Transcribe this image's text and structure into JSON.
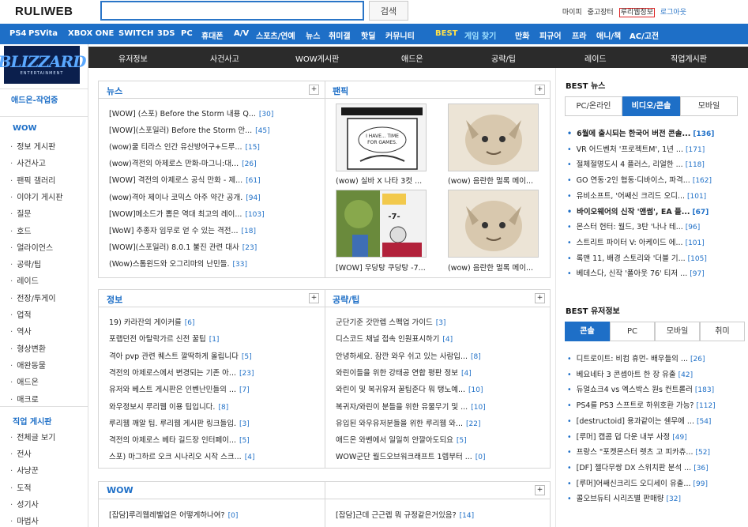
{
  "header": {
    "logo": "RULIWEB",
    "search_placeholder": "",
    "search_button": "검색",
    "links": [
      "마이피",
      "중고장터",
      "루리웹정보",
      "로그아웃"
    ]
  },
  "nav": {
    "items": [
      "PS4",
      "PSVita",
      "XBOX ONE",
      "SWITCH",
      "3DS",
      "PC",
      "휴대폰",
      "A/V",
      "스포츠/연예",
      "뉴스",
      "취미갤",
      "핫딜",
      "커뮤니티",
      "BEST",
      "게임 찾기",
      "만화",
      "피규어",
      "프라",
      "애니/책",
      "AC/고전"
    ]
  },
  "subnav": {
    "items": [
      "유저정보",
      "사건사고",
      "WOW게시판",
      "애드온",
      "공략/팁",
      "레이드",
      "직업게시판"
    ]
  },
  "sidebar": {
    "logo": "BLIZZARD",
    "logo_sub": "ENTERTAINMENT",
    "addon_title": "애드온-작업중",
    "wow_title": "WOW",
    "wow_items": [
      "정보 게시판",
      "사건사고",
      "팬픽 갤러리",
      "이야기 게시판",
      "질문",
      "호드",
      "얼라이언스",
      "공략/팁",
      "레이드",
      "전장/투게이",
      "업적",
      "역사",
      "형상변환",
      "애완동물",
      "애드온",
      "매크로"
    ],
    "job_title": "직업 게시판",
    "job_items": [
      "전체글 보기",
      "전사",
      "사냥꾼",
      "도적",
      "성기사",
      "마법사"
    ]
  },
  "news": {
    "title": "뉴스",
    "items": [
      {
        "text": "[WOW] (스포) Before the Storm 내용 Q...",
        "count": "[30]"
      },
      {
        "text": "[WOW](스포일러) Before the Storm 안...",
        "count": "[45]"
      },
      {
        "text": "(wow)쿨 티라스 인간 유산방어구+드루...",
        "count": "[15]"
      },
      {
        "text": "(wow)격전의 아제로스 만화-마그니:대...",
        "count": "[26]"
      },
      {
        "text": "[WOW] 격전의 아제로스 공식 만화 - 제...",
        "count": "[61]"
      },
      {
        "text": "(wow)격아 제이나 코믹스 아주 약간 공개.",
        "count": "[94]"
      },
      {
        "text": "[WOW]메소드가 뽑은 역대 최고의 레이...",
        "count": "[103]"
      },
      {
        "text": "[WoW] 추종자 임무로 얻 수 있는 격전...",
        "count": "[18]"
      },
      {
        "text": "[WOW](스포일러) 8.0.1 불진 관련 대사",
        "count": "[23]"
      },
      {
        "text": "(Wow)스톰윈드와 오그리마의 난민들.",
        "count": "[33]"
      }
    ]
  },
  "fanfic": {
    "title": "팬픽",
    "items": [
      {
        "caption": "(wow) 실바 X 나타 3컷 ...",
        "art": "I HAVE... TIME FOR GAMES."
      },
      {
        "caption": "(wow) 음란한 멀록 메이...",
        "art": ""
      },
      {
        "caption": "[WOW] 우당탕 쿠당탕 -7...",
        "art": "-7-"
      },
      {
        "caption": "(wow) 음란한 멀록 메이...",
        "art": ""
      }
    ]
  },
  "info": {
    "title": "정보",
    "items": [
      {
        "text": "19) 카라잔의 게이커를",
        "count": "[6]"
      },
      {
        "text": "포랩던전 아탈락가르 신전 꿀팁",
        "count": "[1]"
      },
      {
        "text": "격아 pvp 관련 퀘스트 깔딱하게 올립니다",
        "count": "[5]"
      },
      {
        "text": "격전의 아제로스에서 변경되는 기존 아...",
        "count": "[23]"
      },
      {
        "text": "유저와 베스트 게시판은 인벤난민들의 ...",
        "count": "[7]"
      },
      {
        "text": "와우정보시 루리웹 이용 팁입니다.",
        "count": "[8]"
      },
      {
        "text": "루리웹 깨알 팁. 루리웹 게시판 링크들입.",
        "count": "[3]"
      },
      {
        "text": "격전의 아제로스 베타 길드장 인터페이...",
        "count": "[5]"
      },
      {
        "text": "스포) 마그하르 오크 시나리오 시작 스크...",
        "count": "[4]"
      }
    ]
  },
  "guide": {
    "title": "공략/팁",
    "items": [
      {
        "text": "군단기준 갓만렙 스펙업 가이드",
        "count": "[3]"
      },
      {
        "text": "디스코드 채널 접속 인원표시하기",
        "count": "[4]"
      },
      {
        "text": "안녕하세요. 잠깐 와우 쉬고 있는 사람입...",
        "count": "[8]"
      },
      {
        "text": "와린이들을 위한 강태공 연합 평판 정보",
        "count": "[4]"
      },
      {
        "text": "와린이 및 복귀유저 꿀팁준다 뭐 탱노예...",
        "count": "[10]"
      },
      {
        "text": "복귀자/와린이 분들을 위한 유물무기 및 ...",
        "count": "[10]"
      },
      {
        "text": "유입된 와우유저분들을 위한 루리웹 와...",
        "count": "[22]"
      },
      {
        "text": "애드온 와벤에서 일일히 안깔아도되요",
        "count": "[5]"
      },
      {
        "text": "WOW군단 월드오브워크래프트 1렙부터 ...",
        "count": "[0]"
      }
    ]
  },
  "wowbox": {
    "title": "WOW",
    "left": {
      "text": "[잡담]루리웹레벨업은 어떻게하나여?",
      "count": "[0]"
    },
    "right": {
      "text": "[잡담]근데 근근렙 뭐 규정같은거있음?",
      "count": "[14]"
    }
  },
  "best_news": {
    "title": "BEST 뉴스",
    "tabs": [
      "PC/온라인",
      "비디오/콘솔",
      "모바일"
    ],
    "active": 1,
    "items": [
      {
        "text": "6월에 출시되는 한국어 버전 콘솔...",
        "count": "[136]",
        "bold": true
      },
      {
        "text": "VR 어드벤처 '프로젝트M', 1년 ...",
        "count": "[171]",
        "bold": false
      },
      {
        "text": "절체절명도시 4 플러스, 리얼한 ...",
        "count": "[118]",
        "bold": false
      },
      {
        "text": "GO 연동·2인 협동·디바이스, 파격...",
        "count": "[162]",
        "bold": false
      },
      {
        "text": "유비소프트, '어쌔신 크리드 오디...",
        "count": "[101]",
        "bold": false
      },
      {
        "text": "바이오웨어의 신작 '앤썸', EA 플...",
        "count": "[67]",
        "bold": true
      },
      {
        "text": "몬스터 헌터: 월드, 3탄 '나나 테...",
        "count": "[96]",
        "bold": false
      },
      {
        "text": "스트리트 파이터 V: 아케이드 에...",
        "count": "[101]",
        "bold": false
      },
      {
        "text": "록맨 11, 배경 스토리와 '더블 기...",
        "count": "[105]",
        "bold": false
      },
      {
        "text": "베데스다, 신작 '폴아웃 76' 티저 ...",
        "count": "[97]",
        "bold": false
      }
    ]
  },
  "best_user": {
    "title": "BEST 유저정보",
    "tabs": [
      "콘솔",
      "PC",
      "모바일",
      "취미"
    ],
    "active": 0,
    "items": [
      {
        "text": "디트로이트: 비컴 휴먼- 배우들의 ...",
        "count": "[26]"
      },
      {
        "text": "베요네타 3 콘셉아트 한 장 유출",
        "count": "[42]"
      },
      {
        "text": "듀얼쇼크4 vs 엑스박스 원s 컨트롤러",
        "count": "[183]"
      },
      {
        "text": "PS4를 PS3 스프트로 하위호환 가능?",
        "count": "[112]"
      },
      {
        "text": "[destructoid] 용과같이는 쉔무에 ...",
        "count": "[54]"
      },
      {
        "text": "[루머] 캡콤 덥 다운 내부 사정",
        "count": "[49]"
      },
      {
        "text": "프랑스 \"포켓몬스터 렛츠 고 피카츄...",
        "count": "[52]"
      },
      {
        "text": "[DF] 젤다무쌍 DX 스위치판 분석 ...",
        "count": "[36]"
      },
      {
        "text": "[루머]어쌔신크리드 오디세이 유출...",
        "count": "[99]"
      },
      {
        "text": "콜오브듀티 시리즈별 판매량",
        "count": "[32]"
      }
    ]
  }
}
